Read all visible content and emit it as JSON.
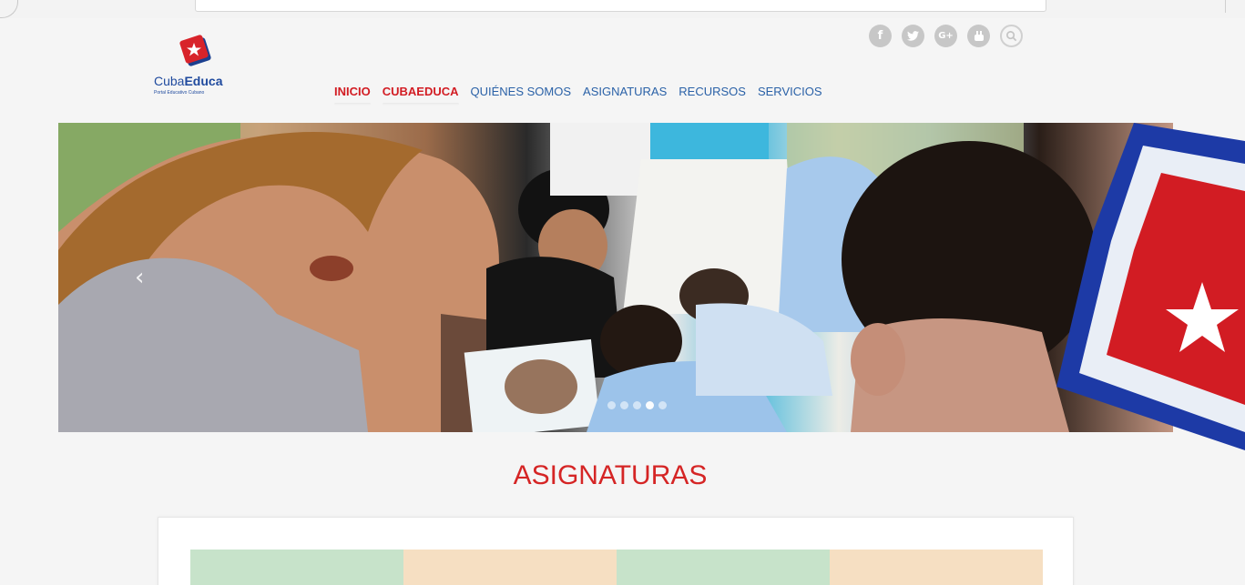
{
  "browser": {
    "search_icon": "search-icon"
  },
  "social": [
    {
      "name": "facebook-icon",
      "glyph": "f"
    },
    {
      "name": "twitter-icon",
      "glyph": "t"
    },
    {
      "name": "google-plus-icon",
      "glyph": "G+"
    },
    {
      "name": "youtube-icon",
      "glyph": "▶"
    },
    {
      "name": "search-icon",
      "glyph": ""
    }
  ],
  "logo": {
    "name_regular": "Cuba",
    "name_bold": "Educa",
    "tagline": "Portal Educativo Cubano"
  },
  "nav": [
    {
      "label": "INICIO",
      "active": true
    },
    {
      "label": "CUBAEDUCA",
      "active": true
    },
    {
      "label": "QUIÉNES SOMOS",
      "active": false
    },
    {
      "label": "ASIGNATURAS",
      "active": false
    },
    {
      "label": "RECURSOS",
      "active": false
    },
    {
      "label": "SERVICIOS",
      "active": false
    }
  ],
  "slider": {
    "prev": "‹",
    "next": "›",
    "slide_count": 5,
    "active_slide": 4
  },
  "section": {
    "title": "ASIGNATURAS"
  },
  "subjects": [
    {
      "color": "#c7e3ca"
    },
    {
      "color": "#f6dfc2"
    },
    {
      "color": "#c7e3ca"
    },
    {
      "color": "#f6dfc2"
    }
  ],
  "colors": {
    "accent_red": "#d21c23",
    "nav_blue": "#2a61a7",
    "title_red": "#d52525",
    "icon_gray": "#c7c7c7"
  }
}
